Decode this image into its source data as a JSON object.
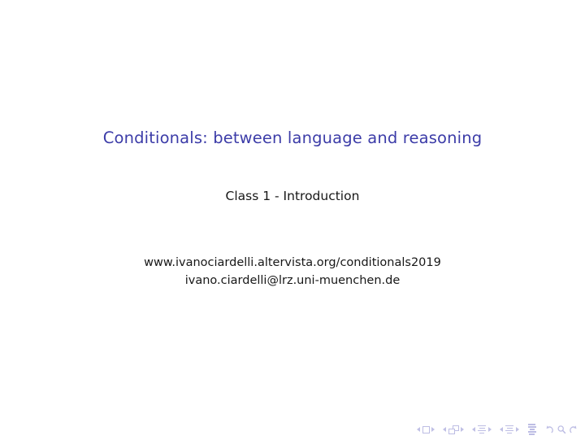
{
  "slide": {
    "background_color": "#ffffff",
    "title": "Conditionals: between language and reasoning",
    "title_color": "#3c3ca8",
    "subtitle": "Class 1 - Introduction",
    "subtitle_color": "#171717",
    "contact": {
      "website": "www.ivanociardelli.altervista.org/conditionals2019",
      "email": "ivano.ciardelli@lrz.uni-muenchen.de",
      "text_color": "#171717"
    }
  },
  "navigation": {
    "color": "#bdbde4",
    "groups": [
      {
        "name": "slide-navigation",
        "prev_label": "Previous slide",
        "icon": "slide-icon",
        "next_label": "Next slide"
      },
      {
        "name": "frame-navigation",
        "prev_label": "Previous frame",
        "icon": "frame-icon",
        "next_label": "Next frame"
      },
      {
        "name": "subsection-navigation",
        "prev_label": "Previous subsection",
        "icon": "subsection-icon",
        "next_label": "Next subsection"
      },
      {
        "name": "section-navigation",
        "prev_label": "Previous section",
        "icon": "section-icon",
        "next_label": "Next section"
      }
    ],
    "document_icon_label": "Document",
    "back_label": "Back",
    "find_label": "Find",
    "forward_label": "Forward"
  }
}
